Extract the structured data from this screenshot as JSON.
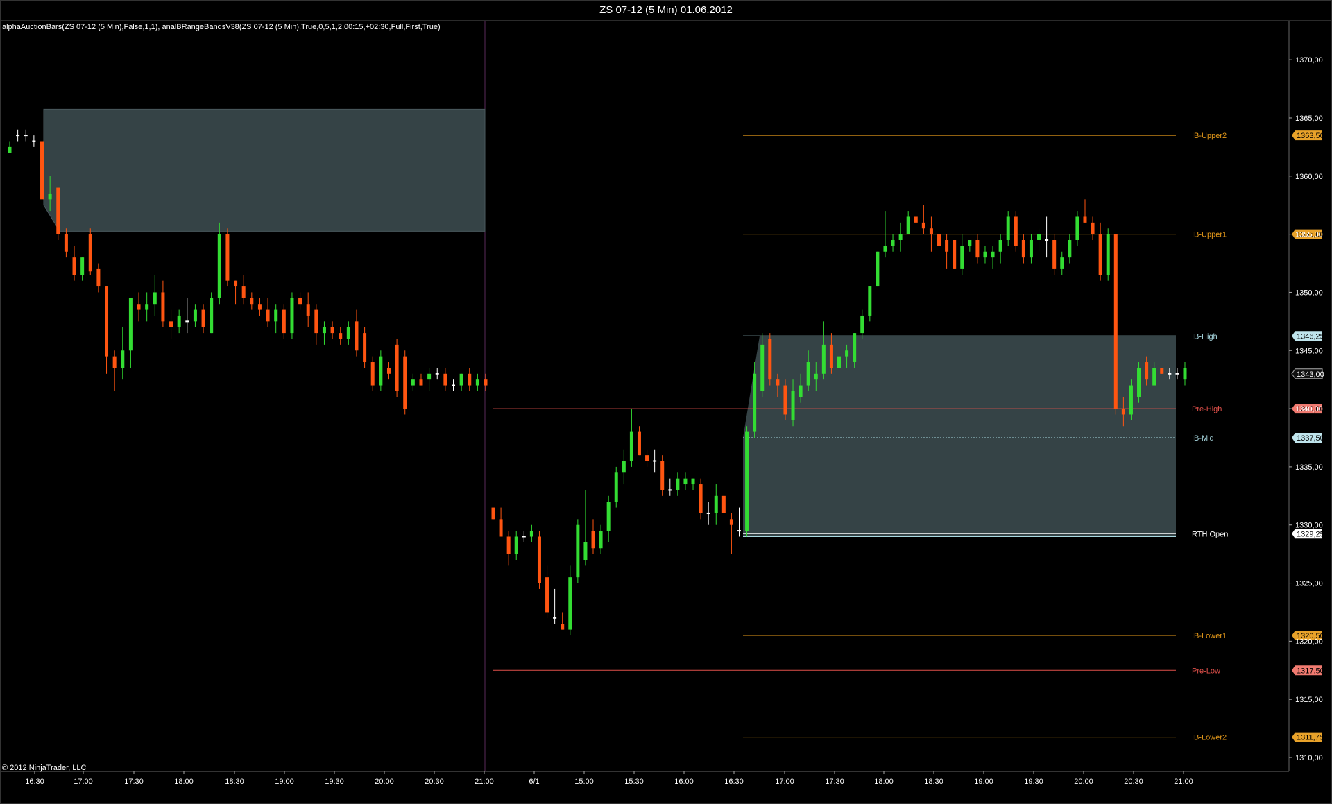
{
  "window": {
    "title": "ZS 07-12 (5 Min)  01.06.2012"
  },
  "indicator_label": "alphaAuctionBars(ZS 07-12 (5 Min),False,1,1), analBRangeBandsV38(ZS 07-12 (5 Min),True,0,5,1,2,00:15,+02:30,Full,First,True)",
  "copyright": "© 2012 NinjaTrader, LLC",
  "colors": {
    "background": "#000000",
    "up_candle": "#33dd33",
    "down_candle": "#ff5511",
    "neutral_candle": "#ffffff",
    "range_fill": "#354346",
    "orange_line": "#e69a1a",
    "red_line": "#e0504a",
    "cyan_line": "#a8d8e0",
    "separator": "#5a2a5a"
  },
  "chart_data": {
    "type": "candlestick",
    "y_axis": {
      "ticks": [
        "1310,00",
        "1315,00",
        "1320,00",
        "1325,00",
        "1330,00",
        "1335,00",
        "1340,00",
        "1345,00",
        "1350,00",
        "1355,00",
        "1360,00",
        "1365,00",
        "1370,00"
      ],
      "range": [
        1307.5,
        1373.5
      ]
    },
    "x_axis": {
      "ticks": [
        "16:30",
        "17:00",
        "17:30",
        "18:00",
        "18:30",
        "19:00",
        "19:30",
        "20:00",
        "20:30",
        "21:00",
        "6/1",
        "15:00",
        "15:30",
        "16:00",
        "16:30",
        "17:00",
        "17:30",
        "18:00",
        "18:30",
        "19:00",
        "19:30",
        "20:00",
        "20:30",
        "21:00"
      ]
    },
    "levels": [
      {
        "label": "IB-Upper2",
        "price": 1363.5,
        "price_label": "1363,50",
        "style": "orange"
      },
      {
        "label": "IB-Upper1",
        "price": 1355.0,
        "price_label": "1355,00",
        "style": "orange"
      },
      {
        "label": "IB-High",
        "price": 1346.25,
        "price_label": "1346,25",
        "style": "cyan"
      },
      {
        "label": "Pre-High",
        "price": 1340.0,
        "price_label": "1340,00",
        "style": "red"
      },
      {
        "label": "IB-Mid",
        "price": 1337.5,
        "price_label": "1337,50",
        "style": "cyan"
      },
      {
        "label": "RTH Open",
        "price": 1329.25,
        "price_label": "1329,25",
        "style": "white"
      },
      {
        "label": "IB-Lower1",
        "price": 1320.5,
        "price_label": "1320,50",
        "style": "orange"
      },
      {
        "label": "Pre-Low",
        "price": 1317.5,
        "price_label": "1317,50",
        "style": "red"
      },
      {
        "label": "IB-Lower2",
        "price": 1311.75,
        "price_label": "1311,75",
        "style": "orange"
      }
    ],
    "current_price": {
      "price": 1343.0,
      "price_label": "1343,00"
    },
    "previous_session_range": {
      "high": 1365.75,
      "low": 1355.25
    },
    "current_session_range": {
      "high": 1346.25,
      "low": 1329.0
    },
    "candles_session1": [
      [
        1362.0,
        1363.0,
        1362.0,
        1362.5
      ],
      [
        1363.5,
        1364.0,
        1363.0,
        1363.5
      ],
      [
        1363.5,
        1364.0,
        1363.0,
        1363.5
      ],
      [
        1363.0,
        1363.5,
        1362.5,
        1363.0
      ],
      [
        1363.0,
        1365.5,
        1357.0,
        1358.0
      ],
      [
        1358.0,
        1360.0,
        1357.0,
        1358.5
      ],
      [
        1359.0,
        1359.0,
        1354.5,
        1355.0
      ],
      [
        1355.0,
        1355.5,
        1353.0,
        1353.5
      ],
      [
        1353.0,
        1354.0,
        1351.0,
        1351.5
      ],
      [
        1351.5,
        1353.0,
        1351.0,
        1353.0
      ],
      [
        1355.0,
        1355.5,
        1351.5,
        1351.8
      ],
      [
        1352.0,
        1352.5,
        1350.0,
        1350.5
      ],
      [
        1350.5,
        1350.5,
        1343.0,
        1344.5
      ],
      [
        1344.5,
        1345.0,
        1341.5,
        1343.5
      ],
      [
        1343.5,
        1347.0,
        1342.5,
        1345.0
      ],
      [
        1345.0,
        1349.5,
        1343.5,
        1349.5
      ],
      [
        1349.0,
        1350.0,
        1347.5,
        1348.5
      ],
      [
        1348.5,
        1350.0,
        1347.5,
        1349.0
      ],
      [
        1349.0,
        1351.5,
        1348.0,
        1350.0
      ],
      [
        1350.0,
        1351.0,
        1347.0,
        1347.5
      ],
      [
        1347.5,
        1348.5,
        1346.0,
        1347.0
      ],
      [
        1347.0,
        1348.5,
        1346.5,
        1348.0
      ],
      [
        1347.5,
        1349.5,
        1346.5,
        1347.5
      ],
      [
        1347.5,
        1349.0,
        1347.0,
        1348.5
      ],
      [
        1348.5,
        1349.0,
        1346.5,
        1347.0
      ],
      [
        1346.5,
        1350.0,
        1346.5,
        1349.5
      ],
      [
        1349.5,
        1356.0,
        1349.0,
        1355.0
      ],
      [
        1355.0,
        1355.5,
        1350.5,
        1351.0
      ],
      [
        1351.0,
        1351.0,
        1349.0,
        1350.5
      ],
      [
        1350.5,
        1351.5,
        1349.0,
        1349.5
      ],
      [
        1349.5,
        1350.0,
        1348.5,
        1349.0
      ],
      [
        1349.0,
        1349.5,
        1348.0,
        1348.5
      ],
      [
        1348.5,
        1349.5,
        1347.0,
        1347.5
      ],
      [
        1347.5,
        1349.0,
        1346.5,
        1348.5
      ],
      [
        1348.5,
        1349.0,
        1346.0,
        1346.5
      ],
      [
        1346.5,
        1350.0,
        1346.0,
        1349.5
      ],
      [
        1349.5,
        1350.0,
        1348.5,
        1349.0
      ],
      [
        1349.0,
        1350.0,
        1347.0,
        1348.0
      ],
      [
        1348.5,
        1349.0,
        1345.5,
        1346.5
      ],
      [
        1346.5,
        1347.5,
        1345.5,
        1347.0
      ],
      [
        1347.0,
        1347.5,
        1346.0,
        1346.5
      ],
      [
        1346.5,
        1347.0,
        1345.5,
        1346.0
      ],
      [
        1346.0,
        1347.5,
        1345.5,
        1347.0
      ],
      [
        1347.5,
        1348.5,
        1344.5,
        1345.0
      ],
      [
        1346.5,
        1347.0,
        1343.5,
        1344.0
      ],
      [
        1344.0,
        1344.5,
        1341.5,
        1342.0
      ],
      [
        1342.0,
        1345.0,
        1341.5,
        1344.5
      ],
      [
        1343.5,
        1344.0,
        1342.5,
        1343.0
      ],
      [
        1345.5,
        1346.0,
        1341.0,
        1341.5
      ],
      [
        1344.5,
        1345.0,
        1339.5,
        1340.0
      ],
      [
        1342.0,
        1343.0,
        1341.5,
        1342.5
      ],
      [
        1342.5,
        1343.0,
        1342.0,
        1342.0
      ],
      [
        1342.5,
        1343.5,
        1341.5,
        1343.0
      ],
      [
        1343.0,
        1343.5,
        1342.5,
        1343.0
      ],
      [
        1343.0,
        1343.5,
        1341.5,
        1342.0
      ],
      [
        1342.0,
        1342.5,
        1341.5,
        1342.0
      ],
      [
        1342.0,
        1343.0,
        1341.5,
        1343.0
      ],
      [
        1343.0,
        1343.5,
        1341.5,
        1342.0
      ],
      [
        1342.0,
        1343.0,
        1341.5,
        1342.5
      ],
      [
        1342.5,
        1343.0,
        1341.5,
        1342.0
      ]
    ],
    "candles_session2": [
      [
        1331.5,
        1331.5,
        1330.5,
        1330.5
      ],
      [
        1330.5,
        1331.5,
        1329.0,
        1329.0
      ],
      [
        1329.0,
        1329.5,
        1326.5,
        1327.5
      ],
      [
        1327.5,
        1329.5,
        1327.0,
        1329.0
      ],
      [
        1329.0,
        1329.5,
        1328.5,
        1329.0
      ],
      [
        1329.0,
        1330.0,
        1328.5,
        1329.5
      ],
      [
        1329.0,
        1329.5,
        1324.5,
        1325.0
      ],
      [
        1325.5,
        1326.5,
        1322.0,
        1322.5
      ],
      [
        1322.0,
        1324.5,
        1321.5,
        1322.0
      ],
      [
        1321.5,
        1322.5,
        1321.0,
        1321.0
      ],
      [
        1321.0,
        1326.5,
        1320.5,
        1325.5
      ],
      [
        1325.5,
        1330.5,
        1325.0,
        1330.0
      ],
      [
        1327.0,
        1333.0,
        1326.5,
        1328.5
      ],
      [
        1329.5,
        1330.5,
        1327.5,
        1328.0
      ],
      [
        1328.0,
        1330.0,
        1327.5,
        1329.5
      ],
      [
        1329.5,
        1332.5,
        1328.5,
        1332.0
      ],
      [
        1332.0,
        1335.0,
        1331.5,
        1334.5
      ],
      [
        1334.5,
        1336.5,
        1333.5,
        1335.5
      ],
      [
        1335.5,
        1340.0,
        1335.0,
        1338.0
      ],
      [
        1338.0,
        1338.5,
        1336.0,
        1336.0
      ],
      [
        1336.0,
        1336.5,
        1335.0,
        1335.5
      ],
      [
        1335.5,
        1336.5,
        1334.5,
        1335.5
      ],
      [
        1335.5,
        1336.0,
        1332.5,
        1333.0
      ],
      [
        1333.0,
        1334.0,
        1332.5,
        1333.0
      ],
      [
        1333.0,
        1334.5,
        1332.5,
        1334.0
      ],
      [
        1333.5,
        1334.5,
        1333.0,
        1334.0
      ],
      [
        1333.5,
        1334.0,
        1333.0,
        1334.0
      ],
      [
        1333.5,
        1334.0,
        1330.5,
        1331.0
      ],
      [
        1331.0,
        1332.0,
        1330.0,
        1331.0
      ],
      [
        1331.0,
        1333.5,
        1330.0,
        1332.5
      ],
      [
        1332.5,
        1332.5,
        1331.0,
        1331.0
      ],
      [
        1330.5,
        1331.0,
        1327.5,
        1330.0
      ],
      [
        1329.5,
        1331.5,
        1329.0,
        1329.5
      ],
      [
        1329.5,
        1338.5,
        1329.0,
        1338.0
      ],
      [
        1338.0,
        1344.0,
        1337.5,
        1343.0
      ],
      [
        1341.5,
        1346.5,
        1341.0,
        1345.5
      ],
      [
        1346.0,
        1346.5,
        1342.0,
        1342.5
      ],
      [
        1342.5,
        1343.0,
        1341.0,
        1342.0
      ],
      [
        1342.0,
        1342.5,
        1339.0,
        1339.5
      ],
      [
        1339.0,
        1342.5,
        1338.5,
        1341.5
      ],
      [
        1341.0,
        1343.0,
        1340.5,
        1342.0
      ],
      [
        1342.0,
        1345.0,
        1341.5,
        1344.0
      ],
      [
        1342.5,
        1344.0,
        1341.5,
        1343.0
      ],
      [
        1343.0,
        1347.5,
        1342.5,
        1345.5
      ],
      [
        1345.5,
        1346.5,
        1343.0,
        1343.5
      ],
      [
        1343.5,
        1344.5,
        1343.0,
        1344.5
      ],
      [
        1344.5,
        1345.5,
        1343.5,
        1345.0
      ],
      [
        1344.0,
        1346.5,
        1343.5,
        1346.5
      ],
      [
        1346.5,
        1348.5,
        1346.0,
        1348.0
      ],
      [
        1348.0,
        1350.5,
        1347.5,
        1350.5
      ],
      [
        1350.5,
        1353.5,
        1350.5,
        1353.5
      ],
      [
        1353.5,
        1357.0,
        1353.0,
        1354.0
      ],
      [
        1354.0,
        1355.0,
        1353.5,
        1354.5
      ],
      [
        1354.5,
        1356.0,
        1353.5,
        1355.0
      ],
      [
        1355.0,
        1357.0,
        1355.0,
        1356.5
      ],
      [
        1356.5,
        1356.5,
        1356.0,
        1356.0
      ],
      [
        1356.0,
        1357.5,
        1355.0,
        1355.5
      ],
      [
        1355.5,
        1356.5,
        1353.5,
        1355.0
      ],
      [
        1355.0,
        1355.5,
        1353.0,
        1354.0
      ],
      [
        1354.5,
        1355.0,
        1352.0,
        1353.5
      ],
      [
        1354.5,
        1354.5,
        1352.0,
        1352.0
      ],
      [
        1352.0,
        1355.0,
        1351.5,
        1354.0
      ],
      [
        1354.0,
        1354.5,
        1353.5,
        1354.5
      ],
      [
        1354.5,
        1355.0,
        1352.5,
        1353.0
      ],
      [
        1353.0,
        1354.0,
        1352.5,
        1353.5
      ],
      [
        1353.0,
        1354.0,
        1352.0,
        1353.5
      ],
      [
        1353.5,
        1355.0,
        1352.5,
        1354.5
      ],
      [
        1354.5,
        1357.0,
        1354.0,
        1356.5
      ],
      [
        1356.5,
        1357.0,
        1353.5,
        1354.0
      ],
      [
        1354.5,
        1355.0,
        1352.5,
        1353.0
      ],
      [
        1353.0,
        1355.0,
        1352.5,
        1354.5
      ],
      [
        1354.5,
        1355.5,
        1353.5,
        1355.0
      ],
      [
        1354.5,
        1356.5,
        1353.0,
        1354.5
      ],
      [
        1354.5,
        1355.0,
        1351.5,
        1352.0
      ],
      [
        1352.0,
        1353.5,
        1351.5,
        1353.0
      ],
      [
        1353.0,
        1355.0,
        1352.5,
        1354.5
      ],
      [
        1354.5,
        1357.0,
        1354.0,
        1356.5
      ],
      [
        1356.5,
        1358.0,
        1356.0,
        1356.0
      ],
      [
        1356.0,
        1356.5,
        1354.5,
        1355.0
      ],
      [
        1355.0,
        1356.0,
        1351.0,
        1351.5
      ],
      [
        1351.5,
        1355.5,
        1351.0,
        1355.0
      ],
      [
        1355.0,
        1355.0,
        1339.5,
        1340.0
      ],
      [
        1340.0,
        1341.0,
        1338.5,
        1339.5
      ],
      [
        1339.5,
        1342.5,
        1339.0,
        1342.0
      ],
      [
        1341.0,
        1344.0,
        1340.5,
        1343.5
      ],
      [
        1344.0,
        1344.5,
        1342.0,
        1342.5
      ],
      [
        1342.0,
        1344.0,
        1342.0,
        1343.5
      ],
      [
        1343.5,
        1343.5,
        1343.0,
        1343.0
      ],
      [
        1343.0,
        1343.5,
        1342.5,
        1343.0
      ],
      [
        1343.0,
        1343.5,
        1342.5,
        1343.0
      ],
      [
        1342.5,
        1344.0,
        1342.0,
        1343.5
      ]
    ]
  }
}
